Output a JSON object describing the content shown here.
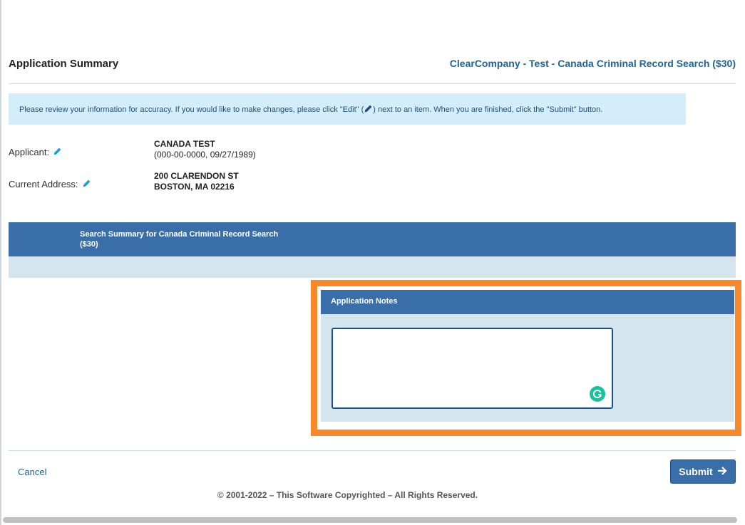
{
  "header": {
    "page_title": "Application Summary",
    "order_title": "ClearCompany - Test - Canada Criminal Record Search ($30)"
  },
  "info": {
    "text_before": "Please review your information for accuracy. If you would like to make changes, please click \"Edit\" (",
    "text_after": ") next to an item. When you are finished, click the \"Submit\" button."
  },
  "applicant": {
    "label": "Applicant:",
    "name": "CANADA TEST",
    "details": "(000-00-0000, 09/27/1989)"
  },
  "address": {
    "label": "Current Address:",
    "line1": "200 CLARENDON ST",
    "line2": "BOSTON, MA 02216"
  },
  "search_summary": {
    "title": "Search Summary for Canada Criminal Record Search ($30)"
  },
  "notes": {
    "title": "Application Notes",
    "value": ""
  },
  "footer": {
    "cancel_label": "Cancel",
    "submit_label": "Submit",
    "copyright": "© 2001-2022 – This Software Copyrighted – All Rights Reserved."
  },
  "colors": {
    "accent": "#3a6ea9",
    "highlight": "#f7892b",
    "link": "#1e6496",
    "info_bg": "#d3eefa"
  },
  "icons": {
    "edit": "pencil-icon",
    "submit": "arrow-right-icon",
    "grammarly": "grammarly-icon"
  }
}
